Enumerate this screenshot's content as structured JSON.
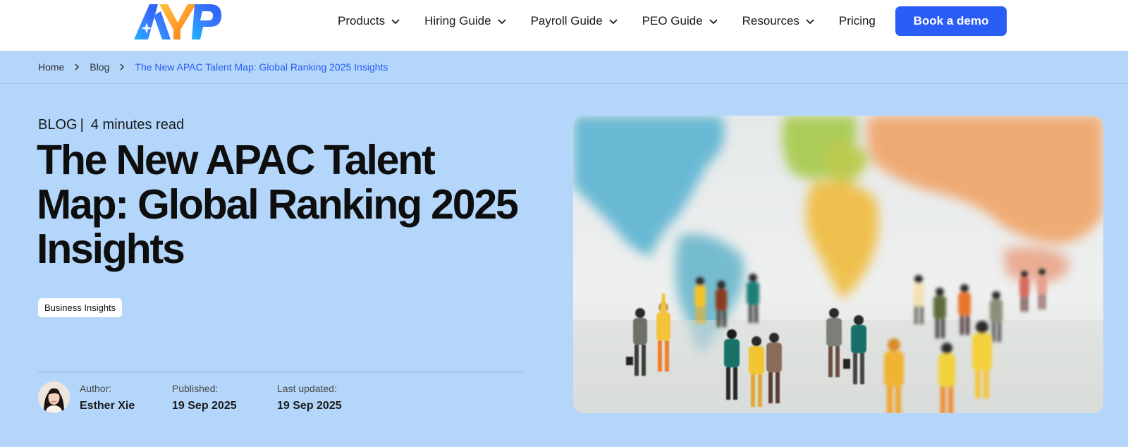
{
  "brand": {
    "logo_text": "AYP",
    "accent_color": "#2a5cf6",
    "hero_bg": "#b3d6fa"
  },
  "nav": {
    "items": [
      {
        "label": "Products",
        "icon": "chevron-down-icon"
      },
      {
        "label": "Hiring Guide",
        "icon": "chevron-down-icon"
      },
      {
        "label": "Payroll Guide",
        "icon": "chevron-down-icon"
      },
      {
        "label": "PEO Guide",
        "icon": "chevron-down-icon"
      },
      {
        "label": "Resources",
        "icon": "chevron-down-icon"
      },
      {
        "label": "Pricing"
      }
    ],
    "cta_label": "Book a demo"
  },
  "breadcrumb": {
    "items": [
      "Home",
      "Blog",
      "The New APAC Talent Map: Global Ranking 2025 Insights"
    ],
    "separator_icon": "chevron-right-icon"
  },
  "article": {
    "category": "BLOG",
    "separator": "|",
    "read_time": "4 minutes read",
    "title": "The New APAC Talent Map: Global Ranking 2025 Insights",
    "tag": "Business Insights",
    "author_label": "Author:",
    "author_name": "Esther Xie",
    "published_label": "Published:",
    "published_date": "19 Sep 2025",
    "updated_label": "Last updated:",
    "updated_date": "19 Sep 2025",
    "hero_image": "world-map-with-miniature-people-figurines"
  }
}
